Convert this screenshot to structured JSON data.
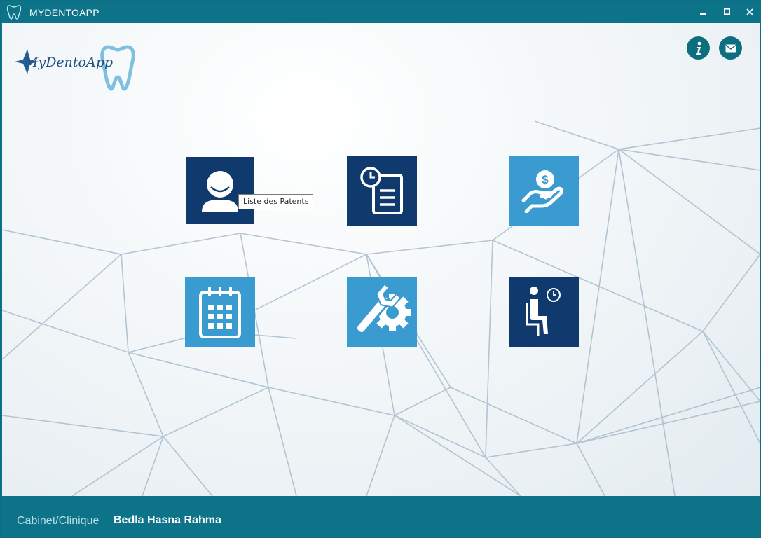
{
  "window": {
    "title": "MYDENTOAPP"
  },
  "logo": {
    "text": "MyDentoApp"
  },
  "header_buttons": [
    {
      "name": "info",
      "icon": "info-icon"
    },
    {
      "name": "mail",
      "icon": "mail-icon"
    }
  ],
  "tiles": [
    {
      "icon": "patient-icon",
      "color": "#10396d"
    },
    {
      "icon": "appointment-clipboard-icon",
      "color": "#10396d"
    },
    {
      "icon": "payment-hand-icon",
      "color": "#3a9bd0"
    },
    {
      "icon": "calendar-icon",
      "color": "#3a9bd0"
    },
    {
      "icon": "settings-tools-icon",
      "color": "#3a9bd0"
    },
    {
      "icon": "waiting-room-icon",
      "color": "#10396d"
    }
  ],
  "tooltip": {
    "text": "Liste des Patents"
  },
  "footer": {
    "label": "Cabinet/Clinique",
    "value": "Bedla Hasna Rahma"
  },
  "colors": {
    "titlebar": "#0d7389",
    "tile_dark": "#10396d",
    "tile_light": "#3a9bd0"
  }
}
